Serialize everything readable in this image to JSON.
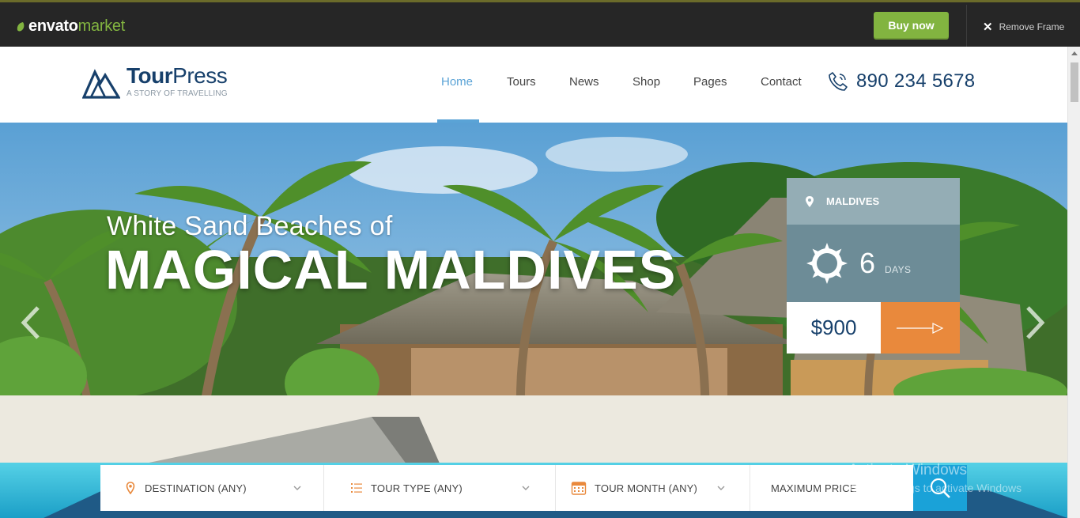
{
  "envato": {
    "logo_primary": "envato",
    "logo_secondary": "market",
    "buy_label": "Buy now",
    "remove_label": "Remove Frame",
    "accent": "#82b440"
  },
  "site": {
    "logo_name_bold": "Tour",
    "logo_name_light": "Press",
    "logo_tagline": "A STORY OF TRAVELLING",
    "phone": "890 234 5678",
    "brand_color": "#17406b",
    "nav": [
      {
        "label": "Home",
        "active": true
      },
      {
        "label": "Tours",
        "active": false
      },
      {
        "label": "News",
        "active": false
      },
      {
        "label": "Shop",
        "active": false
      },
      {
        "label": "Pages",
        "active": false
      },
      {
        "label": "Contact",
        "active": false
      }
    ]
  },
  "hero": {
    "subtitle": "White Sand Beaches of",
    "title": "MAGICAL MALDIVES",
    "card": {
      "location": "MALDIVES",
      "days_value": "6",
      "days_label": "DAYS",
      "price": "$900",
      "go_color": "#e9893c"
    }
  },
  "search": {
    "destination": "DESTINATION (ANY)",
    "tour_type": "TOUR TYPE (ANY)",
    "tour_month": "TOUR MONTH (ANY)",
    "max_price": "MAXIMUM PRICE",
    "button_color": "#1aa2d8"
  },
  "watermark": {
    "line1": "Activate Windows",
    "line2": "Go to Settings to activate Windows"
  }
}
